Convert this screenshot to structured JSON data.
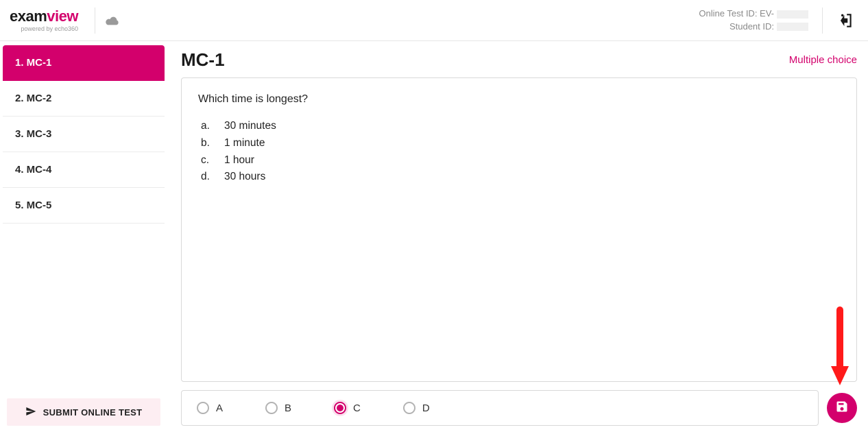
{
  "header": {
    "logo": {
      "part1": "exam",
      "part2": "view",
      "subtitle": "powered by echo360"
    },
    "testIdLabel": "Online Test ID: EV-",
    "studentIdLabel": "Student ID:"
  },
  "sidebar": {
    "items": [
      {
        "label": "1. MC-1",
        "active": true
      },
      {
        "label": "2. MC-2",
        "active": false
      },
      {
        "label": "3. MC-3",
        "active": false
      },
      {
        "label": "4. MC-4",
        "active": false
      },
      {
        "label": "5. MC-5",
        "active": false
      }
    ],
    "submitLabel": "SUBMIT ONLINE TEST"
  },
  "question": {
    "title": "MC-1",
    "typeLabel": "Multiple choice",
    "prompt": "Which time is longest?",
    "options": [
      {
        "letter": "a.",
        "text": "30 minutes"
      },
      {
        "letter": "b.",
        "text": "1 minute"
      },
      {
        "letter": "c.",
        "text": "1 hour"
      },
      {
        "letter": "d.",
        "text": "30 hours"
      }
    ]
  },
  "answer": {
    "choices": [
      {
        "label": "A",
        "selected": false
      },
      {
        "label": "B",
        "selected": false
      },
      {
        "label": "C",
        "selected": true
      },
      {
        "label": "D",
        "selected": false
      }
    ]
  }
}
